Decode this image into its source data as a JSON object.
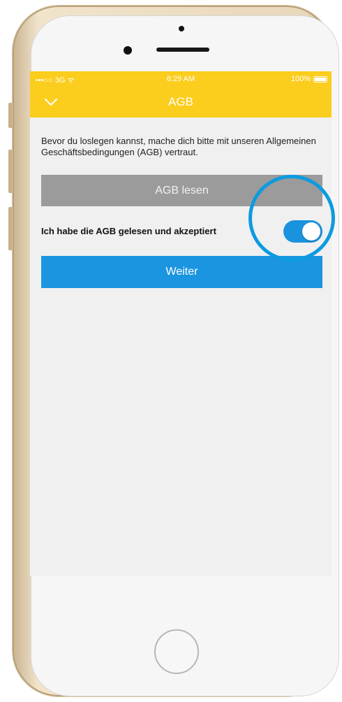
{
  "status_bar": {
    "carrier": "•••○○ 3G  ᯤ",
    "time": "6:29 AM",
    "battery": "100%"
  },
  "nav": {
    "title": "AGB",
    "back_icon": "chevron-down-icon"
  },
  "intro_text": "Bevor du loslegen kannst, mache dich bitte mit unseren Allgemeinen Geschäftsbedingungen (AGB) vertraut.",
  "read_button": {
    "label": "AGB lesen",
    "color": "#9b9b9b"
  },
  "accept_toggle": {
    "label": "Ich habe die AGB gelesen und akzeptiert",
    "on": true,
    "color": "#1a93de"
  },
  "next_button": {
    "label": "Weiter",
    "color": "#1c95e0"
  },
  "colors": {
    "accent": "#fbcd1d",
    "highlight": "#0c9be0",
    "background": "#f0f0f0"
  }
}
